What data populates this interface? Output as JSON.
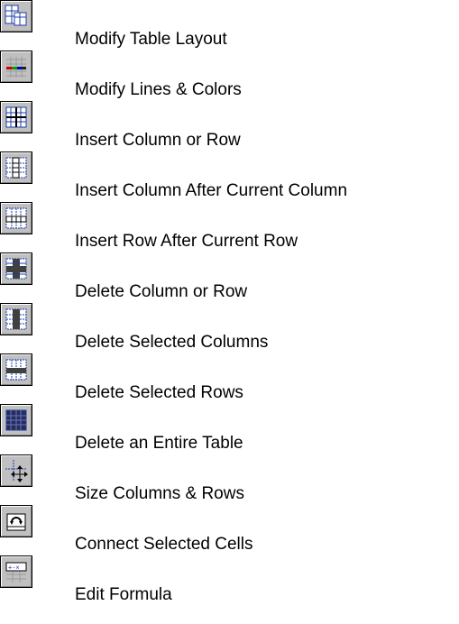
{
  "commands": [
    {
      "label": "Modify Table Layout",
      "icon": "table-layout-icon"
    },
    {
      "label": "Modify Lines & Colors",
      "icon": "lines-colors-icon"
    },
    {
      "label": "Insert Column or Row",
      "icon": "insert-column-row-icon"
    },
    {
      "label": "Insert Column After Current Column",
      "icon": "insert-column-after-icon"
    },
    {
      "label": "Insert Row After Current Row",
      "icon": "insert-row-after-icon"
    },
    {
      "label": "Delete Column or Row",
      "icon": "delete-column-row-icon"
    },
    {
      "label": "Delete Selected Columns",
      "icon": "delete-columns-icon"
    },
    {
      "label": "Delete Selected Rows",
      "icon": "delete-rows-icon"
    },
    {
      "label": "Delete an Entire Table",
      "icon": "delete-table-icon"
    },
    {
      "label": "Size Columns & Rows",
      "icon": "size-columns-rows-icon"
    },
    {
      "label": "Connect Selected Cells",
      "icon": "connect-cells-icon"
    },
    {
      "label": "Edit Formula",
      "icon": "edit-formula-icon"
    }
  ],
  "colors": {
    "button_face": "#c0c0c0",
    "grid_blue": "#1c3ca8",
    "dark_cell": "#404040",
    "text": "#000000"
  }
}
